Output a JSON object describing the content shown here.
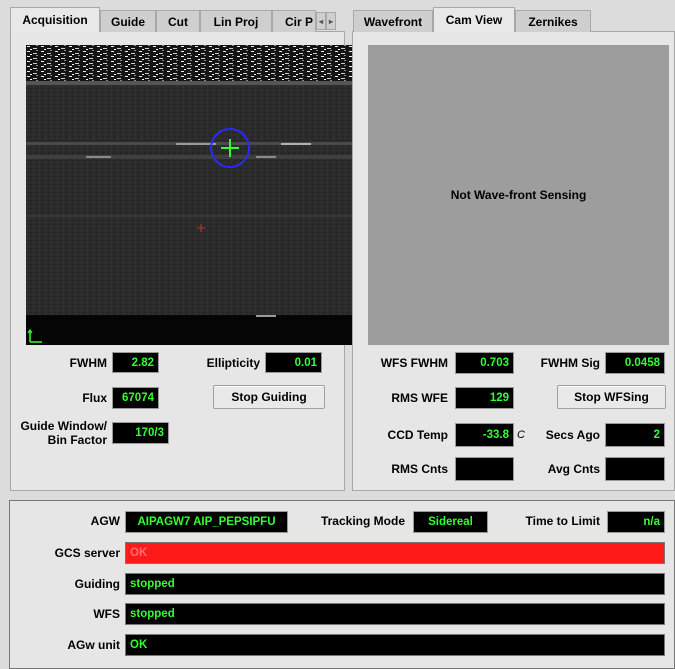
{
  "left_tabs": [
    "Acquisition",
    "Guide",
    "Cut",
    "Lin Proj",
    "Cir P"
  ],
  "right_tabs": [
    "Wavefront",
    "Cam View",
    "Zernikes"
  ],
  "cam_message": "Not Wave-front Sensing",
  "left_fields": {
    "fwhm_label": "FWHM",
    "fwhm_value": "2.82",
    "ellipticity_label": "Ellipticity",
    "ellipticity_value": "0.01",
    "flux_label": "Flux",
    "flux_value": "67074",
    "stop_guiding": "Stop Guiding",
    "guide_window_label_1": "Guide Window/",
    "guide_window_label_2": "Bin Factor",
    "guide_window_value": "170/3"
  },
  "right_fields": {
    "wfs_fwhm_label": "WFS FWHM",
    "wfs_fwhm_value": "0.703",
    "fwhm_sig_label": "FWHM Sig",
    "fwhm_sig_value": "0.0458",
    "rms_wfe_label": "RMS WFE",
    "rms_wfe_value": "129",
    "stop_wfsing": "Stop WFSing",
    "ccd_temp_label": "CCD Temp",
    "ccd_temp_value": "-33.8",
    "ccd_temp_unit": "C",
    "secs_ago_label": "Secs Ago",
    "secs_ago_value": "2",
    "rms_cnts_label": "RMS Cnts",
    "rms_cnts_value": "",
    "avg_cnts_label": "Avg Cnts",
    "avg_cnts_value": ""
  },
  "status": {
    "agw_label": "AGW",
    "agw_value": "AIPAGW7 AIP_PEPSIPFU",
    "tracking_label": "Tracking Mode",
    "tracking_value": "Sidereal",
    "time_limit_label": "Time to Limit",
    "time_limit_value": "n/a",
    "gcs_label": "GCS server",
    "gcs_value": "OK",
    "guiding_label": "Guiding",
    "guiding_value": "stopped",
    "wfs_label": "WFS",
    "wfs_value": "stopped",
    "agw_unit_label": "AGw unit",
    "agw_unit_value": "OK"
  },
  "colors": {
    "value_text": "#33ff33",
    "value_bg": "#000000",
    "error_bar": "#ff1a1a",
    "target_circle": "#2a2aff",
    "crosshair": "#33ff33"
  }
}
